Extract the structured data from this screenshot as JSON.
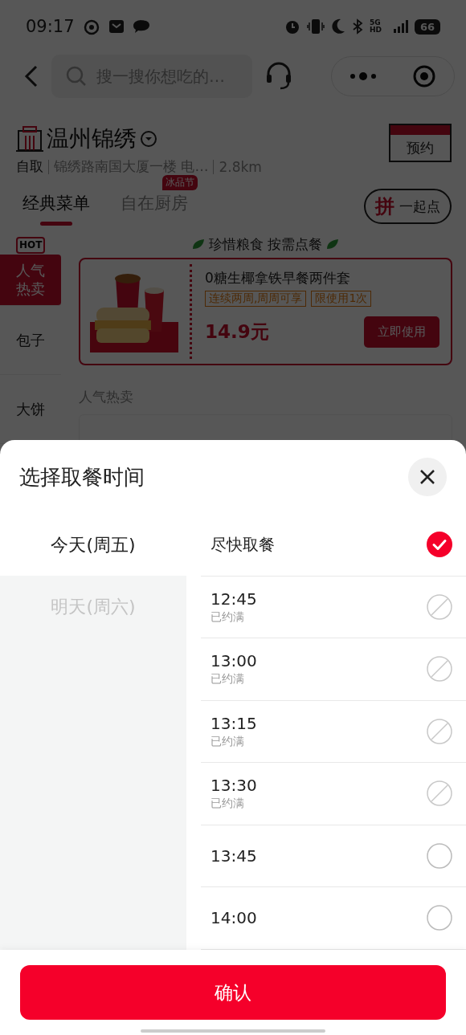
{
  "status_bar": {
    "time": "09:17",
    "network": "5G HD",
    "battery": "66"
  },
  "header": {
    "search": {
      "placeholder": "搜一搜你想吃的…"
    }
  },
  "store": {
    "name": "温州锦绣",
    "mode": "自取",
    "address": "锦绣路南国大厦一楼 电…",
    "distance": "2.8km",
    "reserve_button": "预约"
  },
  "tabs": [
    {
      "label": "经典菜单",
      "selected": true
    },
    {
      "label": "自在厨房",
      "selected": false,
      "badge": "冰品节"
    }
  ],
  "group_order_button": {
    "mark": "拼",
    "label": "一起点"
  },
  "sidebar": {
    "items": [
      {
        "label": "人气热卖",
        "selected": true,
        "badge": "HOT"
      },
      {
        "label": "包子",
        "selected": false
      },
      {
        "label": "大饼",
        "selected": false
      }
    ]
  },
  "slogan": "珍惜粮食 按需点餐",
  "coupon": {
    "title": "0糖生椰拿铁早餐两件套",
    "tags": [
      "连续两周,周周可享",
      "限使用1次"
    ],
    "price": "14.9元",
    "button": "立即使用"
  },
  "section_title": "人气热卖",
  "sheet": {
    "title": "选择取餐时间",
    "days": [
      {
        "label": "今天(周五)",
        "selected": true
      },
      {
        "label": "明天(周六)",
        "selected": false
      }
    ],
    "slots": [
      {
        "time": "尽快取餐",
        "selected": true,
        "disabled": false
      },
      {
        "time": "12:45",
        "note": "已约满",
        "selected": false,
        "disabled": true
      },
      {
        "time": "13:00",
        "note": "已约满",
        "selected": false,
        "disabled": true
      },
      {
        "time": "13:15",
        "note": "已约满",
        "selected": false,
        "disabled": true
      },
      {
        "time": "13:30",
        "note": "已约满",
        "selected": false,
        "disabled": true
      },
      {
        "time": "13:45",
        "selected": false,
        "disabled": false
      },
      {
        "time": "14:00",
        "selected": false,
        "disabled": false
      }
    ],
    "confirm_button": "确认"
  }
}
